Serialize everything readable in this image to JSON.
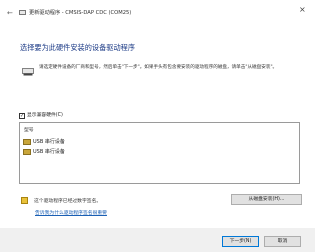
{
  "window": {
    "title": "更新驱动程序 - CMSIS-DAP CDC (COM25)",
    "close_glyph": "×",
    "back_glyph": "←"
  },
  "main": {
    "heading": "选择要为此硬件安装的设备驱动程序",
    "instructions": "请选定硬件设备的厂商和型号，然后单击\"下一步\"。如果手头有包含要安装的驱动程序的磁盘，请单击\"从磁盘安装\"。"
  },
  "compat": {
    "checkbox_label": "显示兼容硬件(C)",
    "checked": true,
    "check_glyph": "✓"
  },
  "driver_list": {
    "column_header": "型号",
    "items": [
      {
        "label": "USB 串行设备"
      },
      {
        "label": "USB 串行设备"
      }
    ]
  },
  "signature": {
    "status_text": "这个驱动程序已经过数字签名。",
    "link_text": "告诉我为什么驱动程序签名很重要"
  },
  "buttons": {
    "have_disk": "从磁盘安装(H)...",
    "next": "下一步(N)",
    "cancel": "取消"
  },
  "icons": {
    "device": "computer-device-icon",
    "shield": "signed-shield-icon",
    "driver": "usb-driver-icon"
  },
  "colors": {
    "heading": "#1e3c87",
    "link": "#1a5fb4",
    "accent": "#0078d7"
  }
}
